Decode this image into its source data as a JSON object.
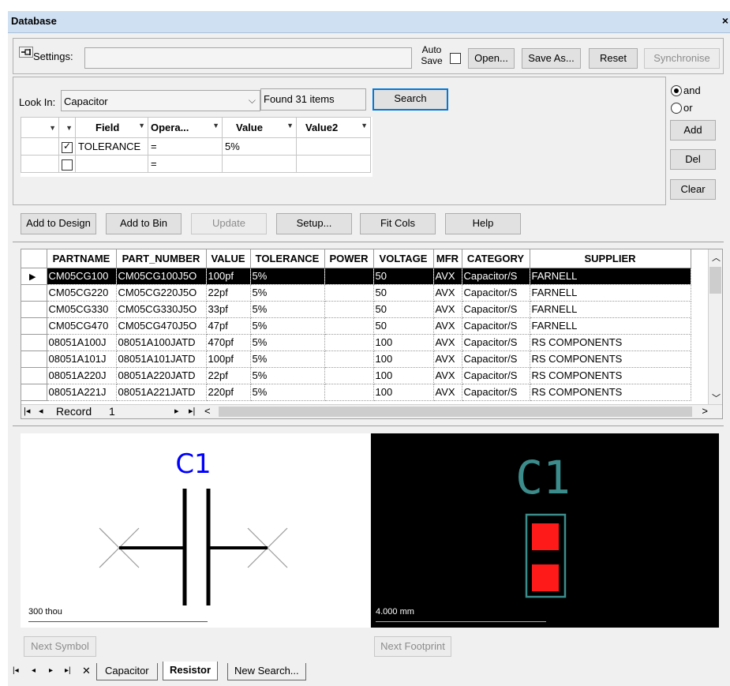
{
  "window": {
    "title": "Database",
    "close_glyph": "×"
  },
  "settings": {
    "label": "Settings:",
    "value": "",
    "auto_save_label": "Auto Save",
    "auto_save_checked": false,
    "open_label": "Open...",
    "save_as_label": "Save As...",
    "reset_label": "Reset",
    "synchronise_label": "Synchronise"
  },
  "search": {
    "look_in_label": "Look In:",
    "look_in_value": "Capacitor",
    "found_text": "Found 31 items",
    "search_label": "Search",
    "and_label": "and",
    "or_label": "or",
    "and_selected": true,
    "add_label": "Add",
    "del_label": "Del",
    "clear_label": "Clear",
    "columns": [
      "Field",
      "Opera...",
      "Value",
      "Value2"
    ],
    "rows": [
      {
        "checked": true,
        "field": "TOLERANCE",
        "operator": "=",
        "value": "5%",
        "value2": ""
      },
      {
        "checked": false,
        "field": "",
        "operator": "=",
        "value": "",
        "value2": ""
      }
    ]
  },
  "actions": {
    "add_to_design": "Add to Design",
    "add_to_bin": "Add to Bin",
    "update": "Update",
    "setup": "Setup...",
    "fit_cols": "Fit Cols",
    "help": "Help"
  },
  "results": {
    "columns": [
      "PARTNAME",
      "PART_NUMBER",
      "VALUE",
      "TOLERANCE",
      "POWER",
      "VOLTAGE",
      "MFR",
      "CATEGORY",
      "SUPPLIER"
    ],
    "rows": [
      [
        "CM05CG100",
        "CM05CG100J5O",
        "100pf",
        "5%",
        "",
        "50",
        "AVX",
        "Capacitor/S",
        "FARNELL"
      ],
      [
        "CM05CG220",
        "CM05CG220J5O",
        "22pf",
        "5%",
        "",
        "50",
        "AVX",
        "Capacitor/S",
        "FARNELL"
      ],
      [
        "CM05CG330",
        "CM05CG330J5O",
        "33pf",
        "5%",
        "",
        "50",
        "AVX",
        "Capacitor/S",
        "FARNELL"
      ],
      [
        "CM05CG470",
        "CM05CG470J5O",
        "47pf",
        "5%",
        "",
        "50",
        "AVX",
        "Capacitor/S",
        "FARNELL"
      ],
      [
        "08051A100J",
        "08051A100JATD",
        "470pf",
        "5%",
        "",
        "100",
        "AVX",
        "Capacitor/S",
        "RS COMPONENTS"
      ],
      [
        "08051A101J",
        "08051A101JATD",
        "100pf",
        "5%",
        "",
        "100",
        "AVX",
        "Capacitor/S",
        "RS COMPONENTS"
      ],
      [
        "08051A220J",
        "08051A220JATD",
        "22pf",
        "5%",
        "",
        "100",
        "AVX",
        "Capacitor/S",
        "RS COMPONENTS"
      ],
      [
        "08051A221J",
        "08051A221JATD",
        "220pf",
        "5%",
        "",
        "100",
        "AVX",
        "Capacitor/S",
        "RS COMPONENTS"
      ]
    ],
    "selected_row": 0,
    "record_label": "Record",
    "record_value": "1"
  },
  "preview": {
    "symbol_designator": "C1",
    "symbol_scale": "300 thou",
    "footprint_designator": "C1",
    "footprint_scale": "4.000 mm",
    "next_symbol": "Next Symbol",
    "next_footprint": "Next Footprint",
    "colors": {
      "symbol_text": "#0000ff",
      "footprint_text": "#3c8c8c",
      "pad": "#ff1a1a",
      "outline": "#3c8c8c"
    }
  },
  "tabs": [
    "Capacitor",
    "Resistor",
    "New Search..."
  ],
  "active_tab": 1
}
